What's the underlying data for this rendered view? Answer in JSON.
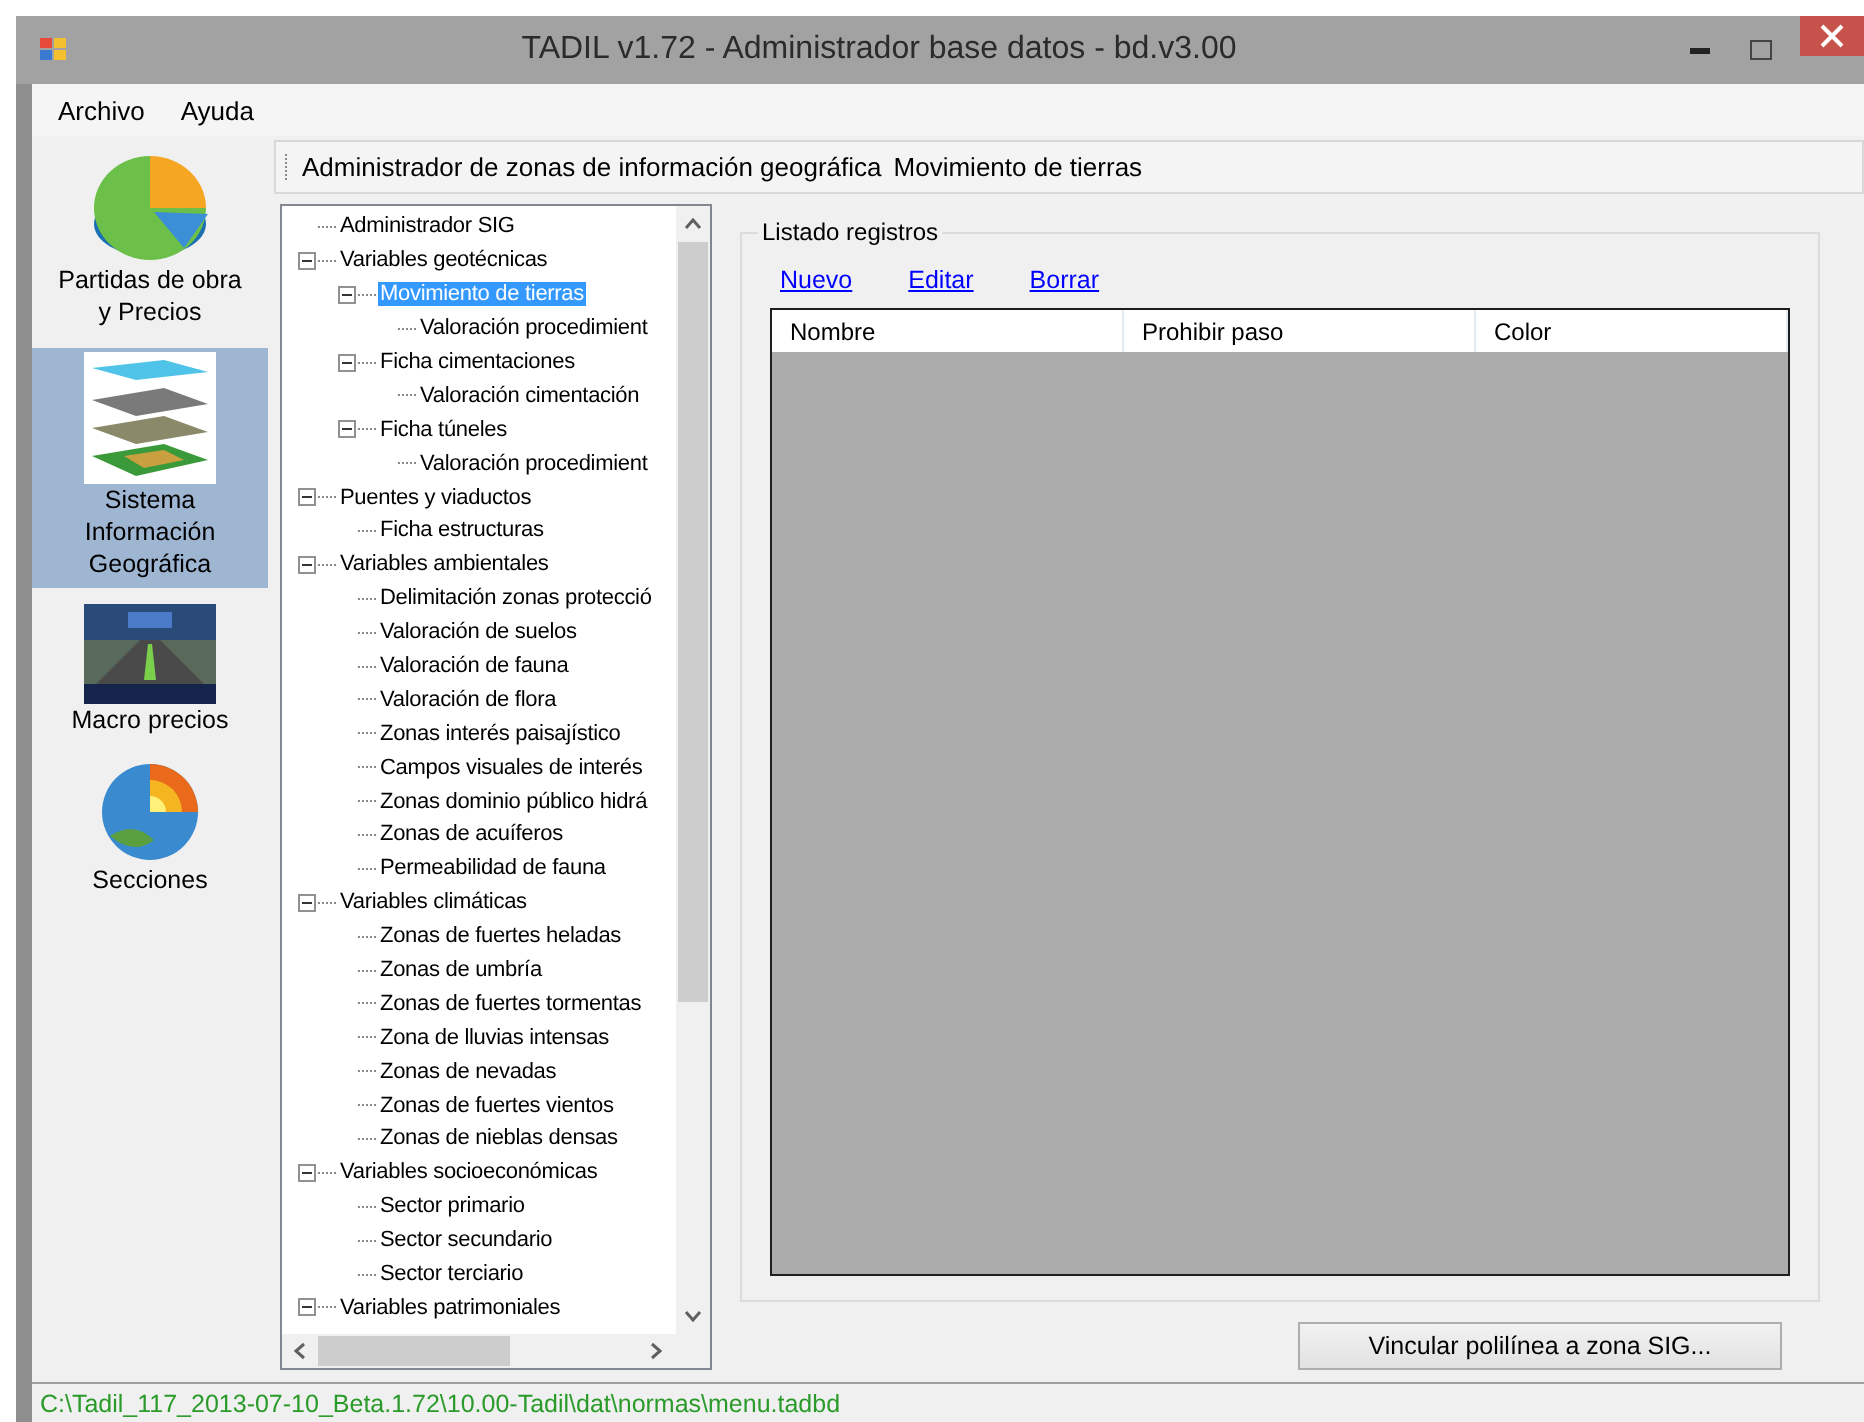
{
  "window": {
    "title": "TADIL v1.72 - Administrador base datos - bd.v3.00"
  },
  "menu": [
    "Archivo",
    "Ayuda"
  ],
  "sidebar": {
    "items": [
      {
        "label": "Partidas de obra y Precios",
        "kind": "pie",
        "selected": false
      },
      {
        "label": "Sistema Información Geográfica",
        "kind": "layers",
        "selected": true
      },
      {
        "label": "Macro precios",
        "kind": "road",
        "selected": false
      },
      {
        "label": "Secciones",
        "kind": "globe",
        "selected": false
      }
    ]
  },
  "breadcrumb": [
    "Administrador de zonas de información geográfica",
    "Movimiento de tierras"
  ],
  "tree": [
    {
      "label": "Administrador SIG",
      "selected": false
    },
    {
      "label": "Variables geotécnicas",
      "selected": false,
      "expanded": true,
      "children": [
        {
          "label": "Movimiento de tierras",
          "selected": true,
          "expanded": true,
          "children": [
            {
              "label": "Valoración procedimient",
              "selected": false
            }
          ]
        },
        {
          "label": "Ficha cimentaciones",
          "selected": false,
          "expanded": true,
          "children": [
            {
              "label": "Valoración cimentación",
              "selected": false
            }
          ]
        },
        {
          "label": "Ficha túneles",
          "selected": false,
          "expanded": true,
          "children": [
            {
              "label": "Valoración procedimient",
              "selected": false
            }
          ]
        }
      ]
    },
    {
      "label": "Puentes y viaductos",
      "selected": false,
      "expanded": true,
      "children": [
        {
          "label": "Ficha estructuras",
          "selected": false
        }
      ]
    },
    {
      "label": "Variables ambientales",
      "selected": false,
      "expanded": true,
      "children": [
        {
          "label": "Delimitación zonas protecció",
          "selected": false
        },
        {
          "label": "Valoración de suelos",
          "selected": false
        },
        {
          "label": "Valoración de fauna",
          "selected": false
        },
        {
          "label": "Valoración de flora",
          "selected": false
        },
        {
          "label": "Zonas interés paisajístico",
          "selected": false
        },
        {
          "label": "Campos visuales de interés",
          "selected": false
        },
        {
          "label": "Zonas dominio público hidrá",
          "selected": false
        },
        {
          "label": "Zonas de acuíferos",
          "selected": false
        },
        {
          "label": "Permeabilidad de fauna",
          "selected": false
        }
      ]
    },
    {
      "label": "Variables climáticas",
      "selected": false,
      "expanded": true,
      "children": [
        {
          "label": "Zonas de fuertes heladas",
          "selected": false
        },
        {
          "label": "Zonas de umbría",
          "selected": false
        },
        {
          "label": "Zonas de fuertes tormentas",
          "selected": false
        },
        {
          "label": "Zona de lluvias intensas",
          "selected": false
        },
        {
          "label": "Zonas de nevadas",
          "selected": false
        },
        {
          "label": "Zonas de fuertes vientos",
          "selected": false
        },
        {
          "label": "Zonas de nieblas densas",
          "selected": false
        }
      ]
    },
    {
      "label": "Variables socioeconómicas",
      "selected": false,
      "expanded": true,
      "children": [
        {
          "label": "Sector primario",
          "selected": false
        },
        {
          "label": "Sector secundario",
          "selected": false
        },
        {
          "label": "Sector terciario",
          "selected": false
        }
      ]
    },
    {
      "label": "Variables patrimoniales",
      "selected": false,
      "expanded": true
    }
  ],
  "records": {
    "title": "Listado registros",
    "actions": [
      "Nuevo",
      "Editar",
      "Borrar"
    ],
    "columns": [
      "Nombre",
      "Prohibir paso",
      "Color"
    ]
  },
  "link_button": "Vincular polilínea a zona SIG...",
  "status_bar": "C:\\Tadil_117_2013-07-10_Beta.1.72\\10.00-Tadil\\dat\\normas\\menu.tadbd"
}
